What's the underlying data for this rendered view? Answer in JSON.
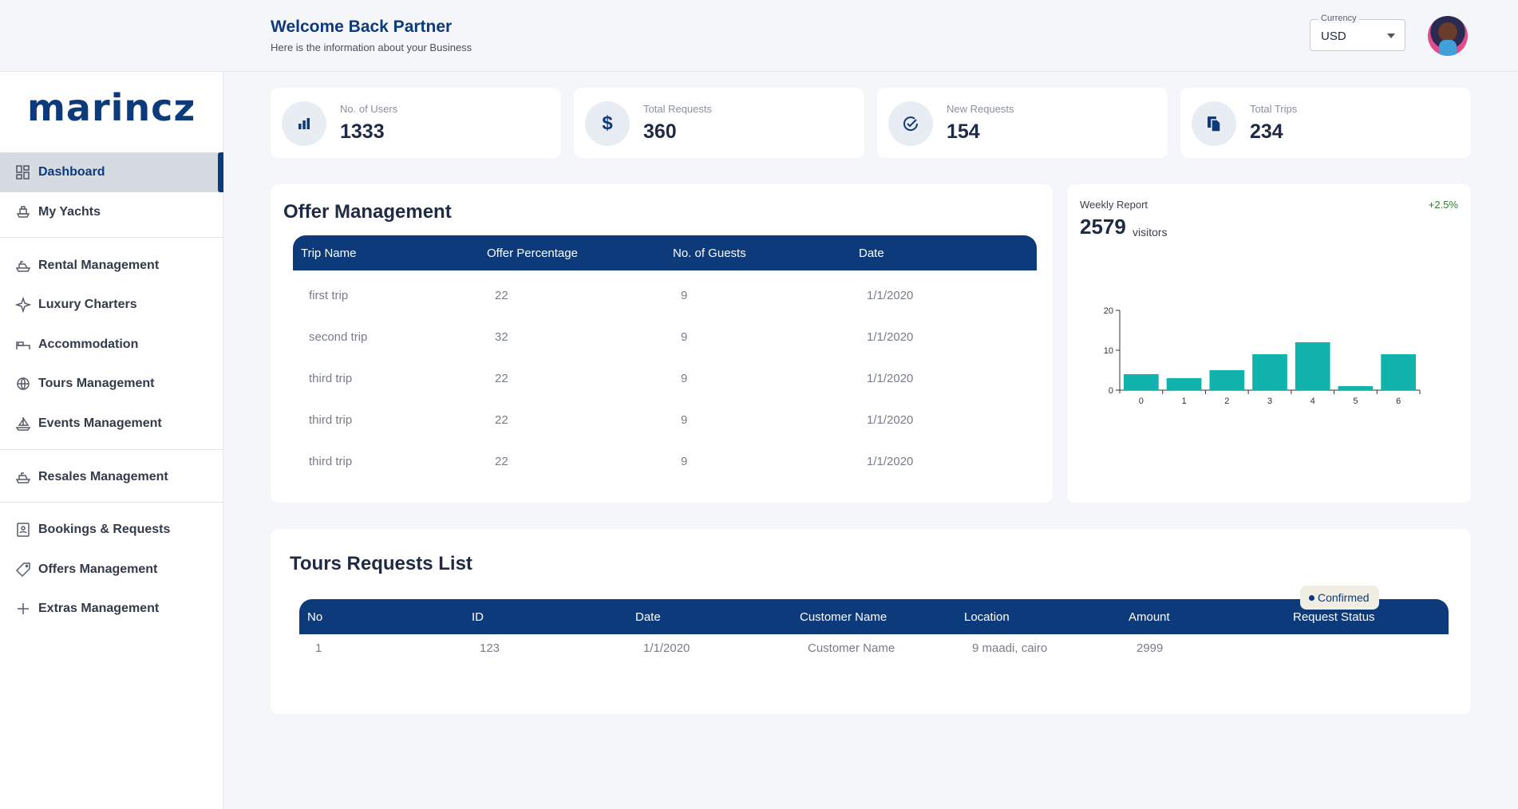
{
  "header": {
    "title": "Welcome Back Partner",
    "subtitle": "Here is the information about your Business",
    "currency_label": "Currency",
    "currency_value": "USD"
  },
  "sidebar": {
    "logo": "marincz",
    "items": [
      {
        "label": "Dashboard",
        "icon": "grid-icon"
      },
      {
        "label": "My Yachts",
        "icon": "yacht-icon"
      },
      {
        "label": "Rental Management",
        "icon": "boat-icon"
      },
      {
        "label": "Luxury Charters",
        "icon": "sparkle-icon"
      },
      {
        "label": "Accommodation",
        "icon": "bed-icon"
      },
      {
        "label": "Tours Management",
        "icon": "globe-icon"
      },
      {
        "label": "Events Management",
        "icon": "sailboat-icon"
      },
      {
        "label": "Resales Management",
        "icon": "ship-icon"
      },
      {
        "label": "Bookings & Requests",
        "icon": "booking-icon"
      },
      {
        "label": "Offers Management",
        "icon": "tag-icon"
      },
      {
        "label": "Extras Management",
        "icon": "plus-icon"
      }
    ]
  },
  "stats": [
    {
      "label": "No. of Users",
      "value": "1333",
      "icon": "bar-chart-icon"
    },
    {
      "label": "Total Requests",
      "value": "360",
      "icon": "dollar-icon"
    },
    {
      "label": "New Requests",
      "value": "154",
      "icon": "check-circle-icon"
    },
    {
      "label": "Total Trips",
      "value": "234",
      "icon": "documents-icon"
    }
  ],
  "offers": {
    "title": "Offer Management",
    "columns": [
      "Trip Name",
      "Offer Percentage",
      "No. of Guests",
      "Date"
    ],
    "rows": [
      [
        "first trip",
        "22",
        "9",
        "1/1/2020"
      ],
      [
        "second trip",
        "32",
        "9",
        "1/1/2020"
      ],
      [
        "third trip",
        "22",
        "9",
        "1/1/2020"
      ],
      [
        "third trip",
        "22",
        "9",
        "1/1/2020"
      ],
      [
        "third trip",
        "22",
        "9",
        "1/1/2020"
      ]
    ]
  },
  "weekly": {
    "label": "Weekly Report",
    "value": "2579",
    "unit": "visitors",
    "change": "+2.5%"
  },
  "chart_data": {
    "type": "bar",
    "categories": [
      "0",
      "1",
      "2",
      "3",
      "4",
      "5",
      "6"
    ],
    "values": [
      4,
      3,
      5,
      9,
      12,
      1,
      9
    ],
    "yticks": [
      "0",
      "10",
      "20"
    ],
    "ylim": [
      0,
      20
    ],
    "color": "#12b3ad"
  },
  "tours": {
    "title": "Tours Requests List",
    "columns": [
      "No",
      "ID",
      "Date",
      "Customer Name",
      "Location",
      "Amount",
      "Request Status"
    ],
    "rows": [
      [
        "1",
        "123",
        "1/1/2020",
        "Customer Name",
        "9 maadi, cairo",
        "2999",
        "Confirmed"
      ]
    ]
  }
}
